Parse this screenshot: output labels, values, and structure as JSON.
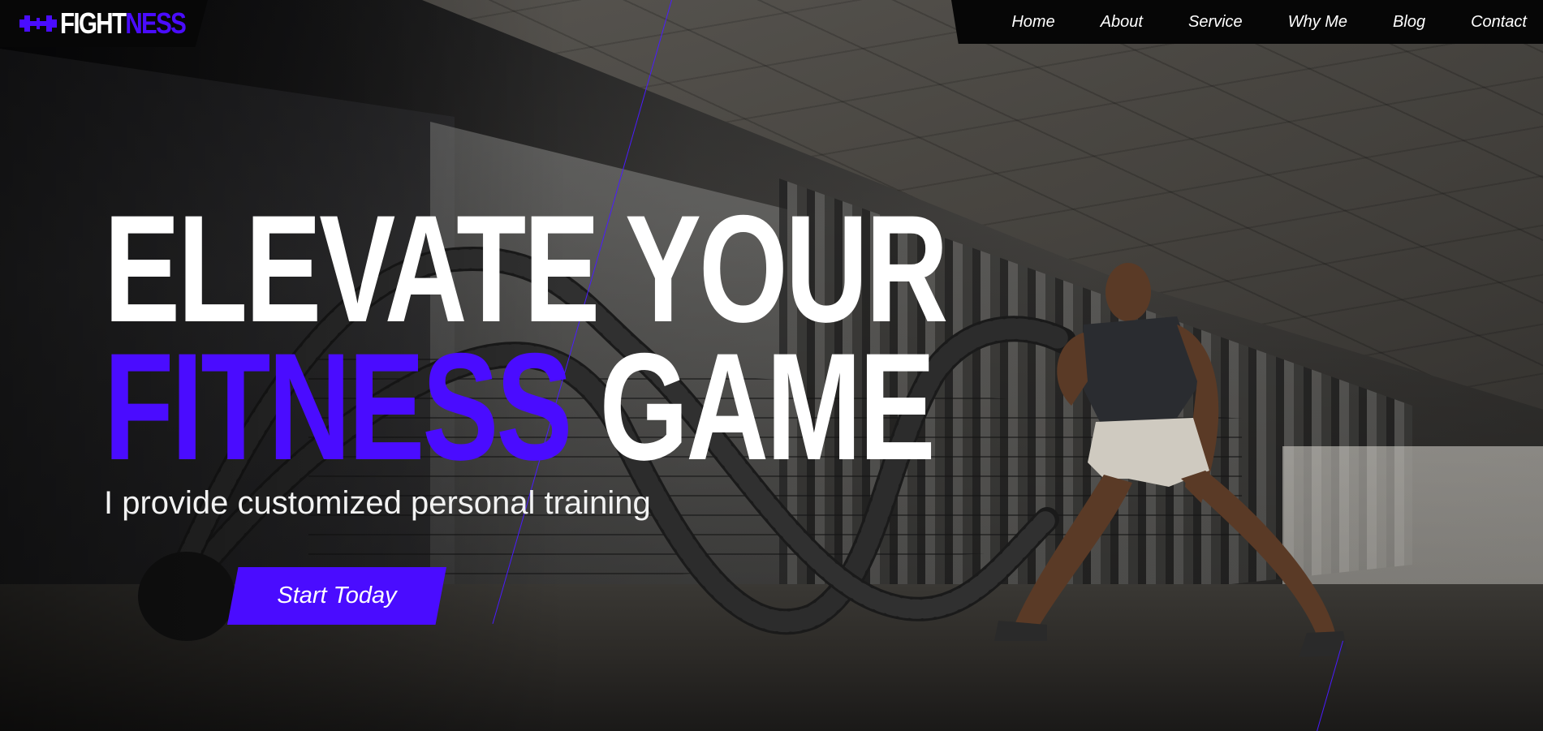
{
  "brand": {
    "name_part1": "FIGHT",
    "name_part2": "NESS",
    "icon": "dumbbell-icon"
  },
  "nav": {
    "items": [
      {
        "label": "Home"
      },
      {
        "label": "About"
      },
      {
        "label": "Service"
      },
      {
        "label": "Why Me"
      },
      {
        "label": "Blog"
      },
      {
        "label": "Contact"
      }
    ]
  },
  "hero": {
    "headline_line1": "ELEVATE YOUR",
    "headline_line2_accent": "FITNESS",
    "headline_line2_rest": "GAME",
    "subtitle": "I provide customized personal training",
    "cta_label": "Start Today",
    "background": "photo of athlete doing battle rope training under a concrete overpass"
  },
  "colors": {
    "accent": "#4a0cff",
    "text": "#ffffff",
    "nav_bg": "#060606"
  }
}
